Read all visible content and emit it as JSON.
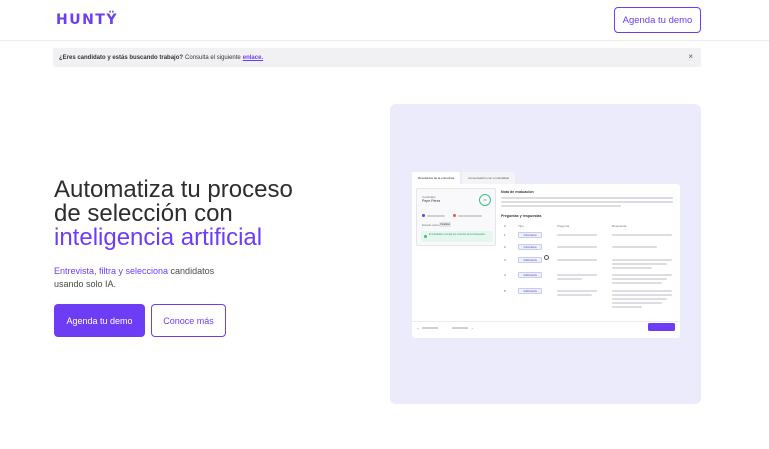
{
  "header": {
    "logo": "HUNTŸ",
    "demo_button": "Agenda tu demo"
  },
  "notice": {
    "bold_text": "¿Eres candidato y estás buscando trabajo?",
    "text": "Consulta el siguiente",
    "link": "enlace.",
    "close": "×"
  },
  "hero": {
    "title_line1": "Automatiza tu proceso",
    "title_line2": "de selección con",
    "title_accent": "inteligencia artificial",
    "subtitle_accent": "Entrevista, filtra y selecciona",
    "subtitle_rest": " candidatos",
    "subtitle_line2": "usando solo IA.",
    "primary_button": "Agenda tu demo",
    "secondary_button": "Conoce más"
  },
  "preview": {
    "tabs": [
      "Resultados de la entrevista",
      "Conversación con el candidato"
    ],
    "candidate_label": "Candidato",
    "candidate_name": "Pepe Pérez",
    "score": "88",
    "status_label": "Estado actual",
    "status_value": "Finalista",
    "green_note": "El candidato cumple los criterios de la búsqueda",
    "eval_title": "Nota de evaluación",
    "qa_title": "Preguntas y respuestas",
    "columns": [
      "#",
      "Tipo",
      "Pregunta",
      "Respuesta"
    ],
    "rows": [
      {
        "n": "1",
        "type": "Informativa"
      },
      {
        "n": "2",
        "type": "Informativa"
      },
      {
        "n": "3",
        "type": "Calificatoria"
      },
      {
        "n": "4",
        "type": "Calificatoria"
      },
      {
        "n": "5",
        "type": "Calificatoria"
      }
    ],
    "prev_arrow": "←",
    "next_arrow": "→"
  },
  "colors": {
    "brand": "#6d3df5",
    "preview_bg": "#ecebfb",
    "notice_bg": "#f1f1f3",
    "success": "#3fbf7f"
  },
  "icons": [
    "close-icon",
    "arrow-left-icon",
    "arrow-right-icon",
    "cursor-icon"
  ]
}
